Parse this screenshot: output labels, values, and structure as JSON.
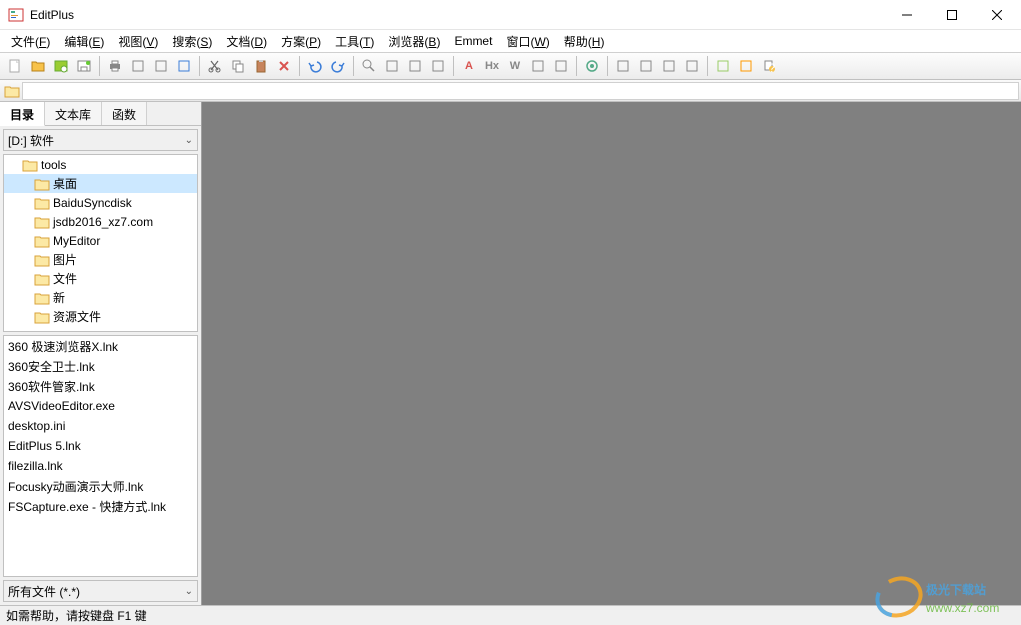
{
  "window": {
    "title": "EditPlus"
  },
  "menus": [
    {
      "label": "文件",
      "key": "F"
    },
    {
      "label": "编辑",
      "key": "E"
    },
    {
      "label": "视图",
      "key": "V"
    },
    {
      "label": "搜索",
      "key": "S"
    },
    {
      "label": "文档",
      "key": "D"
    },
    {
      "label": "方案",
      "key": "P"
    },
    {
      "label": "工具",
      "key": "T"
    },
    {
      "label": "浏览器",
      "key": "B"
    },
    {
      "label": "Emmet",
      "key": ""
    },
    {
      "label": "窗口",
      "key": "W"
    },
    {
      "label": "帮助",
      "key": "H"
    }
  ],
  "toolbar_icons": [
    {
      "name": "new-file-icon",
      "color": "#fff",
      "stroke": "#888"
    },
    {
      "name": "open-file-icon",
      "color": "#f7c24a"
    },
    {
      "name": "open-recent-icon",
      "color": "#9acd32"
    },
    {
      "name": "save-icon",
      "color": "#4a90d9"
    },
    {
      "name": "sep"
    },
    {
      "name": "print-icon",
      "color": "#888"
    },
    {
      "name": "print-preview-icon",
      "color": "#888"
    },
    {
      "name": "arrow-down-icon",
      "color": "#888"
    },
    {
      "name": "code-icon",
      "color": "#3b7dd8"
    },
    {
      "name": "sep"
    },
    {
      "name": "cut-icon",
      "color": "#666"
    },
    {
      "name": "copy-icon",
      "color": "#888"
    },
    {
      "name": "paste-icon",
      "color": "#c7845c"
    },
    {
      "name": "delete-icon",
      "color": "#d9534f"
    },
    {
      "name": "sep"
    },
    {
      "name": "undo-icon",
      "color": "#3b7dd8"
    },
    {
      "name": "redo-icon",
      "color": "#3b7dd8"
    },
    {
      "name": "sep"
    },
    {
      "name": "find-icon",
      "color": "#888"
    },
    {
      "name": "bookmark-icon",
      "color": "#888"
    },
    {
      "name": "replace-icon",
      "color": "#888"
    },
    {
      "name": "goto-icon",
      "color": "#888"
    },
    {
      "name": "sep"
    },
    {
      "name": "font-icon",
      "color": "#d9534f",
      "text": "A"
    },
    {
      "name": "hex-icon",
      "color": "#888",
      "text": "Hx"
    },
    {
      "name": "wrap-icon",
      "color": "#888",
      "text": "W"
    },
    {
      "name": "indent-icon",
      "color": "#888"
    },
    {
      "name": "column-icon",
      "color": "#888"
    },
    {
      "name": "sep"
    },
    {
      "name": "settings-icon",
      "color": "#5a8"
    },
    {
      "name": "sep"
    },
    {
      "name": "window1-icon",
      "color": "#888"
    },
    {
      "name": "window2-icon",
      "color": "#888"
    },
    {
      "name": "window3-icon",
      "color": "#888"
    },
    {
      "name": "window4-icon",
      "color": "#888"
    },
    {
      "name": "sep"
    },
    {
      "name": "tool1-icon",
      "color": "#9c6"
    },
    {
      "name": "tool2-icon",
      "color": "#f90"
    },
    {
      "name": "help-icon",
      "color": "#f7c24a"
    }
  ],
  "sidebar": {
    "tabs": [
      {
        "label": "目录",
        "active": true
      },
      {
        "label": "文本库",
        "active": false
      },
      {
        "label": "函数",
        "active": false
      }
    ],
    "drive": "[D:] 软件",
    "folders": [
      {
        "name": "tools",
        "indent": 14,
        "selected": false
      },
      {
        "name": "桌面",
        "indent": 26,
        "selected": true
      },
      {
        "name": "BaiduSyncdisk",
        "indent": 26,
        "selected": false
      },
      {
        "name": "jsdb2016_xz7.com",
        "indent": 26,
        "selected": false
      },
      {
        "name": "MyEditor",
        "indent": 26,
        "selected": false
      },
      {
        "name": "图片",
        "indent": 26,
        "selected": false
      },
      {
        "name": "文件",
        "indent": 26,
        "selected": false
      },
      {
        "name": "新",
        "indent": 26,
        "selected": false
      },
      {
        "name": "资源文件",
        "indent": 26,
        "selected": false
      }
    ],
    "files": [
      "360 极速浏览器X.lnk",
      "360安全卫士.lnk",
      "360软件管家.lnk",
      "AVSVideoEditor.exe",
      "desktop.ini",
      "EditPlus 5.lnk",
      "filezilla.lnk",
      "Focusky动画演示大师.lnk",
      "FSCapture.exe - 快捷方式.lnk"
    ],
    "filter": "所有文件 (*.*)"
  },
  "statusbar": "如需帮助，请按键盘 F1 键",
  "watermark": {
    "line1": "极光下载站",
    "line2": "www.xz7.com"
  }
}
